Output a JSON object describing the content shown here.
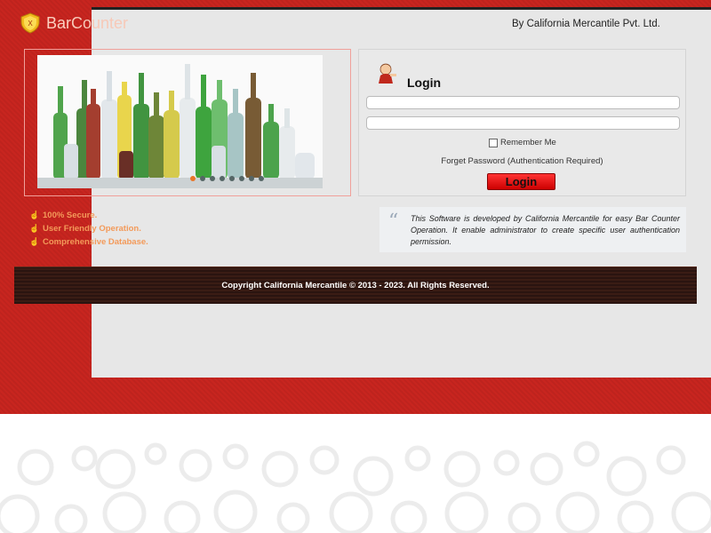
{
  "header": {
    "logo_part1": "Bar",
    "logo_part2": "Counter",
    "byline": "By California Mercantile Pvt. Ltd."
  },
  "slider": {
    "slide_count": 8,
    "active_index": 0
  },
  "login": {
    "title": "Login",
    "username_value": "",
    "password_value": "",
    "remember_label": "Remember Me",
    "remember_checked": false,
    "forgot_link": "Forget Password (Authentication Required)",
    "button_label": "Login"
  },
  "features": [
    {
      "label": "100% Secure."
    },
    {
      "label": "User Friendly Operation."
    },
    {
      "label": "Comprehensive Database."
    }
  ],
  "quote": {
    "text": "This Software is developed by California Mercantile for easy Bar Counter Operation. It enable administrator to create specific user authentication permission."
  },
  "footer": {
    "copyright": "Copyright California Mercantile © 2013 - 2023. All Rights Reserved."
  },
  "colors": {
    "background_red": "#c8251f",
    "button_red": "#e01010",
    "feature_orange": "#f39a5a"
  }
}
